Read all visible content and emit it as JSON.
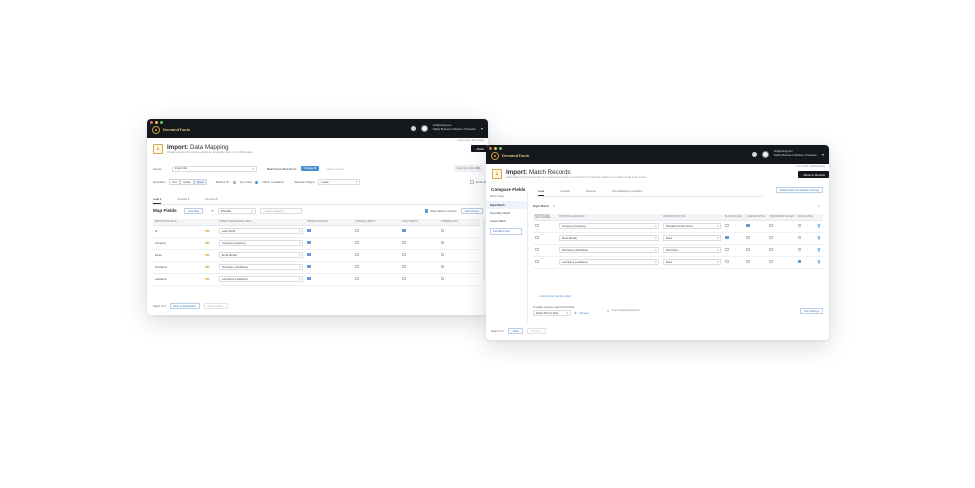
{
  "left_window": {
    "brand": "DemandTools",
    "account": {
      "email": "ultra@ortusg.com",
      "org": "Validity Business Unification • Production"
    },
    "subheader_note": "1 job of 100 | Jobs Usage",
    "back_label": "Back",
    "title_prefix": "Import:",
    "title_rest": " Data Mapping",
    "subtitle": "Update a desired file before selecting an acceptable field to your CRM project.",
    "source_label": "Source",
    "source_value": "Import File",
    "match_label": "Match Down Results for",
    "match_button": "Change All",
    "show_label": "Show Locked",
    "records_label": "Records in File:",
    "records_value": "300",
    "operation_label": "Operation",
    "operations": [
      "New",
      "Update",
      "Upsert"
    ],
    "active_operation": "Upsert",
    "method_label": "Method ID",
    "radio_any": "Any Field",
    "radio_match": "Match Conditions",
    "selection_label": "Selection Object",
    "selection_value": "Leads",
    "audit_label": "Audit off",
    "tabs": [
      "Lead",
      "Contact",
      "Account"
    ],
    "active_tab": "Lead",
    "section_title": "Map Fields",
    "auto_map": "Auto Map",
    "filter_value": "All Fields",
    "search_placeholder": "Search Mapping...",
    "show_blank": "Show Blank Columns",
    "add_column": "Add Column",
    "columns": [
      "IMPORT FILE FIELD",
      "",
      "TARGET SALESFORCE FIELD",
      "UPDATE CONFLICT",
      "UPDATE IF EMPTY",
      "IN NOT EMPTY",
      "COMBINE ONLY"
    ],
    "rows": [
      {
        "source": "Id",
        "target": "Lead (ID/Id)",
        "flags": [
          true,
          false,
          true,
          false
        ]
      },
      {
        "source": "Company",
        "target": "Company (Company)",
        "flags": [
          true,
          false,
          false,
          false
        ]
      },
      {
        "source": "Email",
        "target": "Email (Email)",
        "flags": [
          true,
          false,
          false,
          false
        ]
      },
      {
        "source": "FirstName",
        "target": "First Name (FirstName)",
        "flags": [
          true,
          false,
          false,
          false
        ]
      },
      {
        "source": "LastName",
        "target": "Last Name (LastName)",
        "flags": [
          true,
          false,
          false,
          false
        ]
      }
    ],
    "step_label": "Step 1 of 4",
    "back_step": "Back to Dashboard",
    "next_step": "Match Fields"
  },
  "right_window": {
    "brand": "DemandTools",
    "account": {
      "email": "ultra@ortusg.com",
      "org": "Validity Business Unification • Production"
    },
    "subheader_note": "1 job of 100 | Match Results",
    "back_label": "Back to Results",
    "title_prefix": "Import:",
    "title_rest": " Match Records",
    "subtitle": "Select fields from this import file file to determine whether a record from the import file matches an existing record in the system.",
    "section_title": "Compare Fields",
    "tabs": [
      "Lead",
      "Contact",
      "Account",
      "Post Matching Condition"
    ],
    "active_tab": "Lead",
    "manage_button": "Default Field Comparison Settings",
    "nav_header": "Match Steps",
    "nav_items": [
      "Rigid Match",
      "Secondary Match",
      "Looser Match"
    ],
    "active_nav": "Rigid Match",
    "nav_button": "Add Match Step",
    "step_name": "Rigid Match",
    "columns": [
      "IMPORT FILE FIELD (NAME)",
      "MATCHING LEAD FIELD",
      "COMPARISON TYPE",
      "BLANK VALUES",
      "CASE SENSITIVE",
      "TRANSFORM VALUES",
      "SLIDE CLOSE",
      ""
    ],
    "rows": [
      {
        "source": "Company (Company)",
        "type": "Standard Account Name",
        "flags": [
          false,
          true,
          false,
          false
        ]
      },
      {
        "source": "Email (Email)",
        "type": "Exact",
        "flags": [
          true,
          false,
          false,
          false
        ]
      },
      {
        "source": "First Name (FirstName)",
        "type": "First Name",
        "flags": [
          false,
          false,
          false,
          false
        ]
      },
      {
        "source": "Last Name (LastName)",
        "type": "Exact",
        "flags": [
          false,
          false,
          false,
          true
        ]
      }
    ],
    "add_link": "+ Add another condition field",
    "multiple_note": "If multiple matches, select Winner Rule",
    "winner_value": "Select Winner Rule",
    "manage_link": "Manage",
    "export_note": "Create Fields/Export/Report",
    "test_button": "Test Settings",
    "step_label": "Step 2 of 4",
    "back_step": "Back",
    "next_step": "Process"
  },
  "colors": {
    "titlebar": "#14181d",
    "accent": "#4a8fd4",
    "brand_gold": "#c89a3a"
  }
}
